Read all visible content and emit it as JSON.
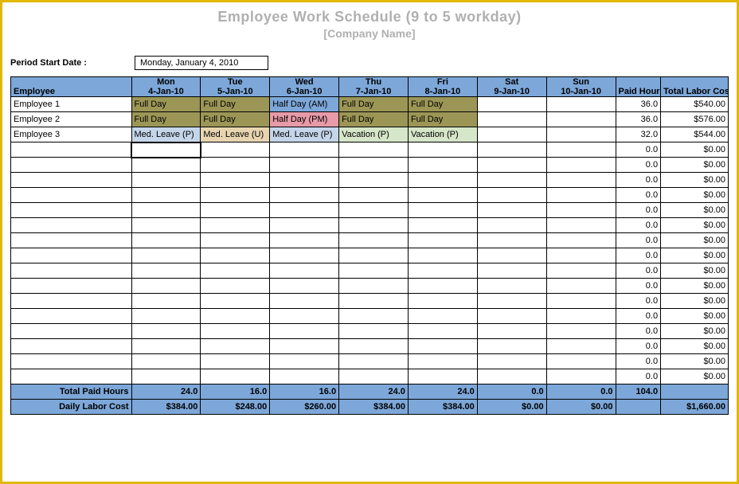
{
  "title": "Employee Work Schedule (9 to 5  workday)",
  "subtitle": "[Company Name]",
  "period_label": "Period Start Date :",
  "period_value": "Monday, January 4, 2010",
  "headers": {
    "employee": "Employee",
    "days": [
      {
        "day": "Mon",
        "date": "4-Jan-10"
      },
      {
        "day": "Tue",
        "date": "5-Jan-10"
      },
      {
        "day": "Wed",
        "date": "6-Jan-10"
      },
      {
        "day": "Thu",
        "date": "7-Jan-10"
      },
      {
        "day": "Fri",
        "date": "8-Jan-10"
      },
      {
        "day": "Sat",
        "date": "9-Jan-10"
      },
      {
        "day": "Sun",
        "date": "10-Jan-10"
      }
    ],
    "paid_hours": "Paid Hours",
    "labor_cost": "Total Labor Cost"
  },
  "rows": [
    {
      "name": "Employee 1",
      "cells": [
        {
          "t": "Full Day",
          "c": "full-day"
        },
        {
          "t": "Full Day",
          "c": "full-day"
        },
        {
          "t": "Half Day (AM)",
          "c": "half-am"
        },
        {
          "t": "Full Day",
          "c": "full-day"
        },
        {
          "t": "Full Day",
          "c": "full-day"
        },
        {
          "t": ""
        },
        {
          "t": ""
        }
      ],
      "hours": "36.0",
      "cost": "$540.00"
    },
    {
      "name": "Employee 2",
      "cells": [
        {
          "t": "Full Day",
          "c": "full-day"
        },
        {
          "t": "Full Day",
          "c": "full-day"
        },
        {
          "t": "Half Day (PM)",
          "c": "half-pm"
        },
        {
          "t": "Full Day",
          "c": "full-day"
        },
        {
          "t": "Full Day",
          "c": "full-day"
        },
        {
          "t": ""
        },
        {
          "t": ""
        }
      ],
      "hours": "36.0",
      "cost": "$576.00"
    },
    {
      "name": "Employee 3",
      "cells": [
        {
          "t": "Med. Leave (P)",
          "c": "med-p"
        },
        {
          "t": "Med. Leave (U)",
          "c": "med-u"
        },
        {
          "t": "Med. Leave (P)",
          "c": "med-p"
        },
        {
          "t": "Vacation (P)",
          "c": "vac-p"
        },
        {
          "t": "Vacation (P)",
          "c": "vac-p"
        },
        {
          "t": ""
        },
        {
          "t": ""
        }
      ],
      "hours": "32.0",
      "cost": "$544.00"
    },
    {
      "name": "",
      "cells": [
        {
          "t": "",
          "sel": true
        },
        {
          "t": ""
        },
        {
          "t": ""
        },
        {
          "t": ""
        },
        {
          "t": ""
        },
        {
          "t": ""
        },
        {
          "t": ""
        }
      ],
      "hours": "0.0",
      "cost": "$0.00"
    },
    {
      "name": "",
      "cells": [
        {
          "t": ""
        },
        {
          "t": ""
        },
        {
          "t": ""
        },
        {
          "t": ""
        },
        {
          "t": ""
        },
        {
          "t": ""
        },
        {
          "t": ""
        }
      ],
      "hours": "0.0",
      "cost": "$0.00"
    },
    {
      "name": "",
      "cells": [
        {
          "t": ""
        },
        {
          "t": ""
        },
        {
          "t": ""
        },
        {
          "t": ""
        },
        {
          "t": ""
        },
        {
          "t": ""
        },
        {
          "t": ""
        }
      ],
      "hours": "0.0",
      "cost": "$0.00"
    },
    {
      "name": "",
      "cells": [
        {
          "t": ""
        },
        {
          "t": ""
        },
        {
          "t": ""
        },
        {
          "t": ""
        },
        {
          "t": ""
        },
        {
          "t": ""
        },
        {
          "t": ""
        }
      ],
      "hours": "0.0",
      "cost": "$0.00"
    },
    {
      "name": "",
      "cells": [
        {
          "t": ""
        },
        {
          "t": ""
        },
        {
          "t": ""
        },
        {
          "t": ""
        },
        {
          "t": ""
        },
        {
          "t": ""
        },
        {
          "t": ""
        }
      ],
      "hours": "0.0",
      "cost": "$0.00"
    },
    {
      "name": "",
      "cells": [
        {
          "t": ""
        },
        {
          "t": ""
        },
        {
          "t": ""
        },
        {
          "t": ""
        },
        {
          "t": ""
        },
        {
          "t": ""
        },
        {
          "t": ""
        }
      ],
      "hours": "0.0",
      "cost": "$0.00"
    },
    {
      "name": "",
      "cells": [
        {
          "t": ""
        },
        {
          "t": ""
        },
        {
          "t": ""
        },
        {
          "t": ""
        },
        {
          "t": ""
        },
        {
          "t": ""
        },
        {
          "t": ""
        }
      ],
      "hours": "0.0",
      "cost": "$0.00"
    },
    {
      "name": "",
      "cells": [
        {
          "t": ""
        },
        {
          "t": ""
        },
        {
          "t": ""
        },
        {
          "t": ""
        },
        {
          "t": ""
        },
        {
          "t": ""
        },
        {
          "t": ""
        }
      ],
      "hours": "0.0",
      "cost": "$0.00"
    },
    {
      "name": "",
      "cells": [
        {
          "t": ""
        },
        {
          "t": ""
        },
        {
          "t": ""
        },
        {
          "t": ""
        },
        {
          "t": ""
        },
        {
          "t": ""
        },
        {
          "t": ""
        }
      ],
      "hours": "0.0",
      "cost": "$0.00"
    },
    {
      "name": "",
      "cells": [
        {
          "t": ""
        },
        {
          "t": ""
        },
        {
          "t": ""
        },
        {
          "t": ""
        },
        {
          "t": ""
        },
        {
          "t": ""
        },
        {
          "t": ""
        }
      ],
      "hours": "0.0",
      "cost": "$0.00"
    },
    {
      "name": "",
      "cells": [
        {
          "t": ""
        },
        {
          "t": ""
        },
        {
          "t": ""
        },
        {
          "t": ""
        },
        {
          "t": ""
        },
        {
          "t": ""
        },
        {
          "t": ""
        }
      ],
      "hours": "0.0",
      "cost": "$0.00"
    },
    {
      "name": "",
      "cells": [
        {
          "t": ""
        },
        {
          "t": ""
        },
        {
          "t": ""
        },
        {
          "t": ""
        },
        {
          "t": ""
        },
        {
          "t": ""
        },
        {
          "t": ""
        }
      ],
      "hours": "0.0",
      "cost": "$0.00"
    },
    {
      "name": "",
      "cells": [
        {
          "t": ""
        },
        {
          "t": ""
        },
        {
          "t": ""
        },
        {
          "t": ""
        },
        {
          "t": ""
        },
        {
          "t": ""
        },
        {
          "t": ""
        }
      ],
      "hours": "0.0",
      "cost": "$0.00"
    },
    {
      "name": "",
      "cells": [
        {
          "t": ""
        },
        {
          "t": ""
        },
        {
          "t": ""
        },
        {
          "t": ""
        },
        {
          "t": ""
        },
        {
          "t": ""
        },
        {
          "t": ""
        }
      ],
      "hours": "0.0",
      "cost": "$0.00"
    },
    {
      "name": "",
      "cells": [
        {
          "t": ""
        },
        {
          "t": ""
        },
        {
          "t": ""
        },
        {
          "t": ""
        },
        {
          "t": ""
        },
        {
          "t": ""
        },
        {
          "t": ""
        }
      ],
      "hours": "0.0",
      "cost": "$0.00"
    },
    {
      "name": "",
      "cells": [
        {
          "t": ""
        },
        {
          "t": ""
        },
        {
          "t": ""
        },
        {
          "t": ""
        },
        {
          "t": ""
        },
        {
          "t": ""
        },
        {
          "t": ""
        }
      ],
      "hours": "0.0",
      "cost": "$0.00"
    }
  ],
  "totals": {
    "paid_hours_label": "Total Paid Hours",
    "paid_hours": [
      "24.0",
      "16.0",
      "16.0",
      "24.0",
      "24.0",
      "0.0",
      "0.0",
      "104.0",
      ""
    ],
    "labor_cost_label": "Daily Labor Cost",
    "labor_cost": [
      "$384.00",
      "$248.00",
      "$260.00",
      "$384.00",
      "$384.00",
      "$0.00",
      "$0.00",
      "",
      "$1,660.00"
    ]
  },
  "dropdown_glyph": "▾"
}
